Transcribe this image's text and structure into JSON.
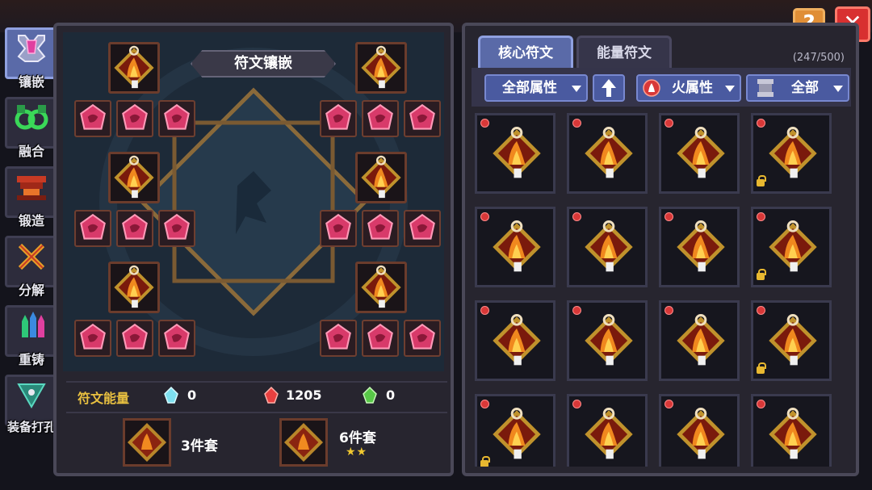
{
  "buttons": {
    "help": "?",
    "close": "✕"
  },
  "nav": [
    {
      "id": "inlay",
      "label": "镶嵌",
      "icon": "gem-inlay-icon",
      "active": true
    },
    {
      "id": "fuse",
      "label": "融合",
      "icon": "fusion-icon",
      "active": false
    },
    {
      "id": "forge",
      "label": "锻造",
      "icon": "anvil-icon",
      "active": false
    },
    {
      "id": "decompose",
      "label": "分解",
      "icon": "decompose-icon",
      "active": false
    },
    {
      "id": "recast",
      "label": "重铸",
      "icon": "recast-icon",
      "active": false
    },
    {
      "id": "socket",
      "label": "装备打孔",
      "icon": "socket-drill-icon",
      "active": false
    }
  ],
  "left": {
    "title": "符文镶嵌",
    "energy_label": "符文能量",
    "energies": [
      {
        "type": "water",
        "value": "0",
        "color": "#7ee0f0"
      },
      {
        "type": "fire",
        "value": "1205",
        "color": "#e84040"
      },
      {
        "type": "nature",
        "value": "0",
        "color": "#58c848"
      }
    ],
    "sets": [
      {
        "label": "3件套",
        "stars": ""
      },
      {
        "label": "6件套",
        "stars": "★★"
      }
    ]
  },
  "right": {
    "tabs": [
      {
        "label": "核心符文",
        "active": true
      },
      {
        "label": "能量符文",
        "active": false
      }
    ],
    "count": "(247/500)",
    "filters": {
      "attribute": "全部属性",
      "sort_icon": "arrow-up-icon",
      "element": "火属性",
      "slot": "全部"
    },
    "cells": [
      {
        "locked": false
      },
      {
        "locked": false
      },
      {
        "locked": false
      },
      {
        "locked": true
      },
      {
        "locked": false
      },
      {
        "locked": false
      },
      {
        "locked": false
      },
      {
        "locked": true
      },
      {
        "locked": false
      },
      {
        "locked": false
      },
      {
        "locked": false
      },
      {
        "locked": true
      },
      {
        "locked": true
      },
      {
        "locked": false
      },
      {
        "locked": false
      },
      {
        "locked": false
      }
    ]
  },
  "colors": {
    "accent": "#5a6aa8",
    "fire": "#d83838",
    "gold": "#e8b830",
    "panel": "#27252f"
  }
}
